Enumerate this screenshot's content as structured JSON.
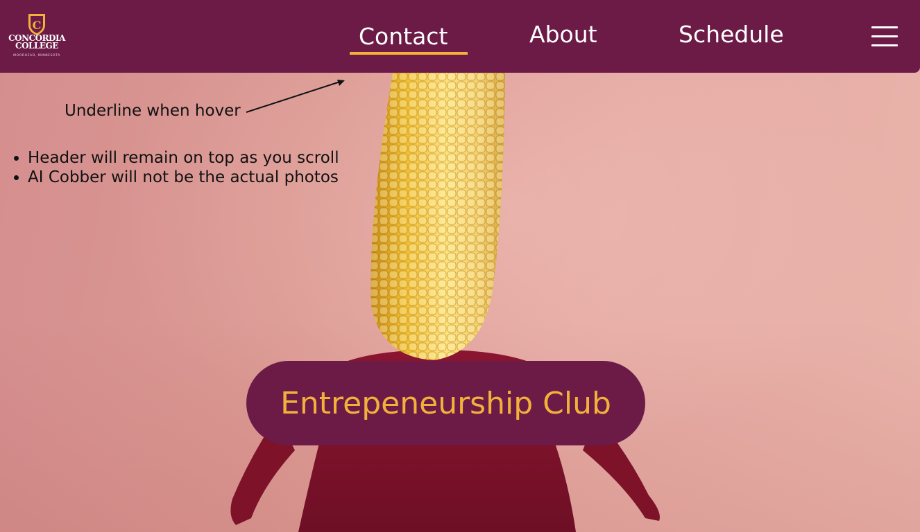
{
  "header": {
    "logo": {
      "line1": "CONCORDIA",
      "line2": "COLLEGE",
      "place": "MOORHEAD, MINNESOTA",
      "shield_letter": "C"
    },
    "nav": {
      "contact": "Contact",
      "about": "About",
      "schedule": "Schedule"
    },
    "menu_icon": "hamburger-menu-icon"
  },
  "annotations": {
    "hover_note": "Underline when hover",
    "notes": [
      "Header will remain on top as you scroll",
      "AI Cobber will not be the actual photos"
    ]
  },
  "hero": {
    "club_title": "Entrepeneurship Club",
    "image_subject": "corn-cob-figure"
  },
  "colors": {
    "header_bg": "#6c1b47",
    "accent_gold": "#f1b13b",
    "text_white": "#ffffff"
  }
}
